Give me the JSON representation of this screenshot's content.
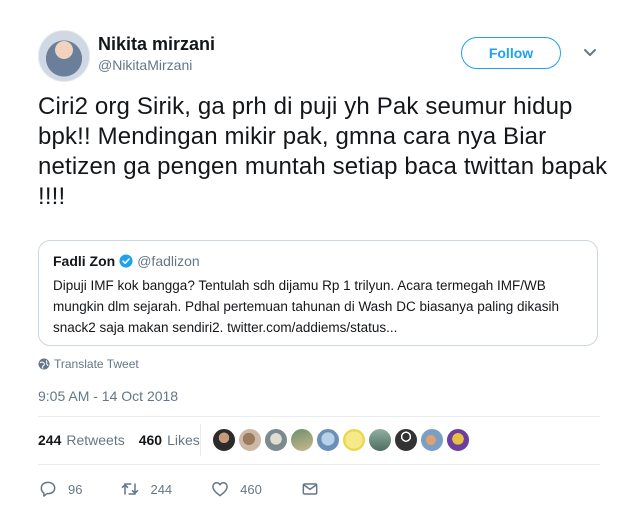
{
  "author": {
    "name": "Nikita mirzani",
    "handle": "@NikitaMirzani"
  },
  "follow_button_label": "Follow",
  "tweet_text": "Ciri2 org Sirik, ga prh di puji yh Pak seumur hidup bpk!! Mendingan mikir pak, gmna cara nya Biar netizen ga pengen muntah setiap baca twittan bapak !!!!",
  "quoted_tweet": {
    "name": "Fadli Zon",
    "handle": "@fadlizon",
    "text": "Dipuji IMF kok bangga? Tentulah sdh dijamu Rp 1 trilyun. Acara termegah IMF/WB mungkin dlm sejarah. Pdhal pertemuan tahunan di Wash DC biasanya paling dikasih snack2 saja makan sendiri2. twitter.com/addiems/status..."
  },
  "translate_label": "Translate Tweet",
  "timestamp": "9:05 AM - 14 Oct 2018",
  "stats": {
    "retweets_count": "244",
    "retweets_label": "Retweets",
    "likes_count": "460",
    "likes_label": "Likes"
  },
  "actions": {
    "reply_count": "96",
    "retweet_count": "244",
    "like_count": "460"
  },
  "colors": {
    "accent": "#1da1f2",
    "secondary_text": "#657786",
    "primary_text": "#14171a"
  }
}
